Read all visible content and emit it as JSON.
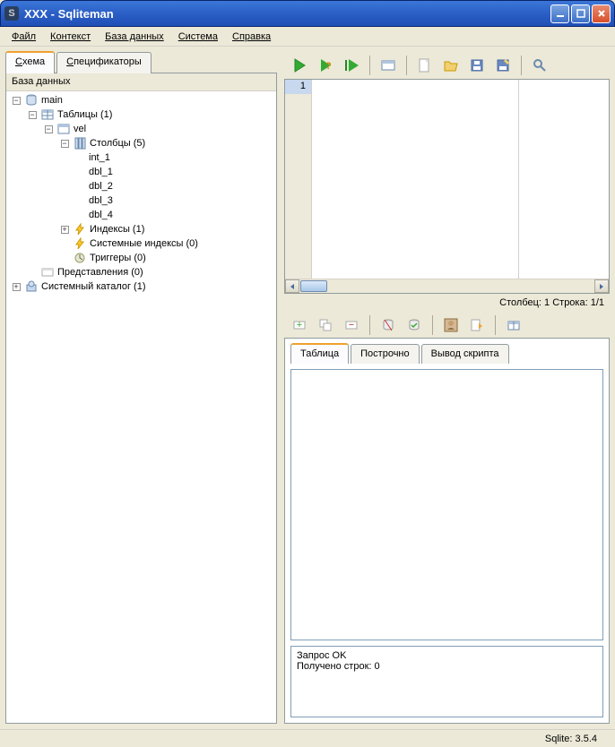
{
  "title": "XXX - Sqliteman",
  "menu": {
    "file": "Файл",
    "context": "Контекст",
    "database": "База данных",
    "system": "Система",
    "help": "Справка"
  },
  "left": {
    "tabs": {
      "schema": "Схема",
      "pragmas": "Спецификаторы"
    },
    "tree_header": "База данных",
    "tree": {
      "main": "main",
      "tables": "Таблицы (1)",
      "table_vel": "vel",
      "columns": "Столбцы (5)",
      "cols": [
        "int_1",
        "dbl_1",
        "dbl_2",
        "dbl_3",
        "dbl_4"
      ],
      "indexes": "Индексы (1)",
      "sys_indexes": "Системные индексы (0)",
      "triggers": "Триггеры (0)",
      "views": "Представления (0)",
      "sys_catalog": "Системный каталог (1)"
    }
  },
  "sql": {
    "line": "1",
    "status": "Столбец: 1 Строка: 1/1"
  },
  "result": {
    "tabs": {
      "table": "Таблица",
      "row": "Построчно",
      "script": "Вывод скрипта"
    },
    "log_line1": "Запрос OK",
    "log_line2": "Получено строк: 0"
  },
  "statusbar": "Sqlite: 3.5.4"
}
